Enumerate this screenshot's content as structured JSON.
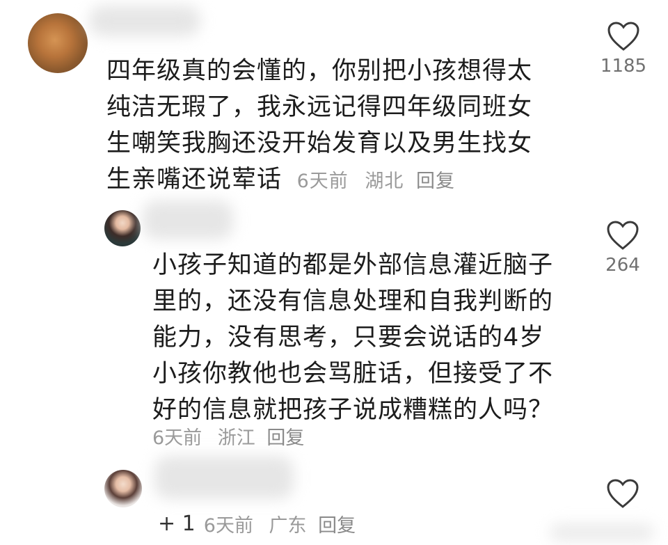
{
  "comments": [
    {
      "text_lines": [
        "四年级真的会懂的，你别把小孩想得太",
        "纯洁无瑕了，我永远记得四年级同班女",
        "生嘲笑我胸还没开始发育以及男生找女",
        "生亲嘴还说荤话"
      ],
      "time": "6天前",
      "location": "湖北",
      "reply_label": "回复",
      "likes": "1185"
    },
    {
      "text_lines": [
        "小孩子知道的都是外部信息灌近脑子",
        "里的，还没有信息处理和自我判断的",
        "能力，没有思考，只要会说话的4岁",
        "小孩你教他也会骂脏话，但接受了不",
        "好的信息就把孩子说成糟糕的人吗？"
      ],
      "time": "6天前",
      "location": "浙江",
      "reply_label": "回复",
      "likes": "264"
    },
    {
      "plus": "+ 1",
      "time": "6天前",
      "location": "广东",
      "reply_label": "回复"
    }
  ],
  "icons": {
    "like": "heart-outline-icon"
  },
  "colors": {
    "meta": "#9a9a9a",
    "text": "#1c1c1c"
  }
}
